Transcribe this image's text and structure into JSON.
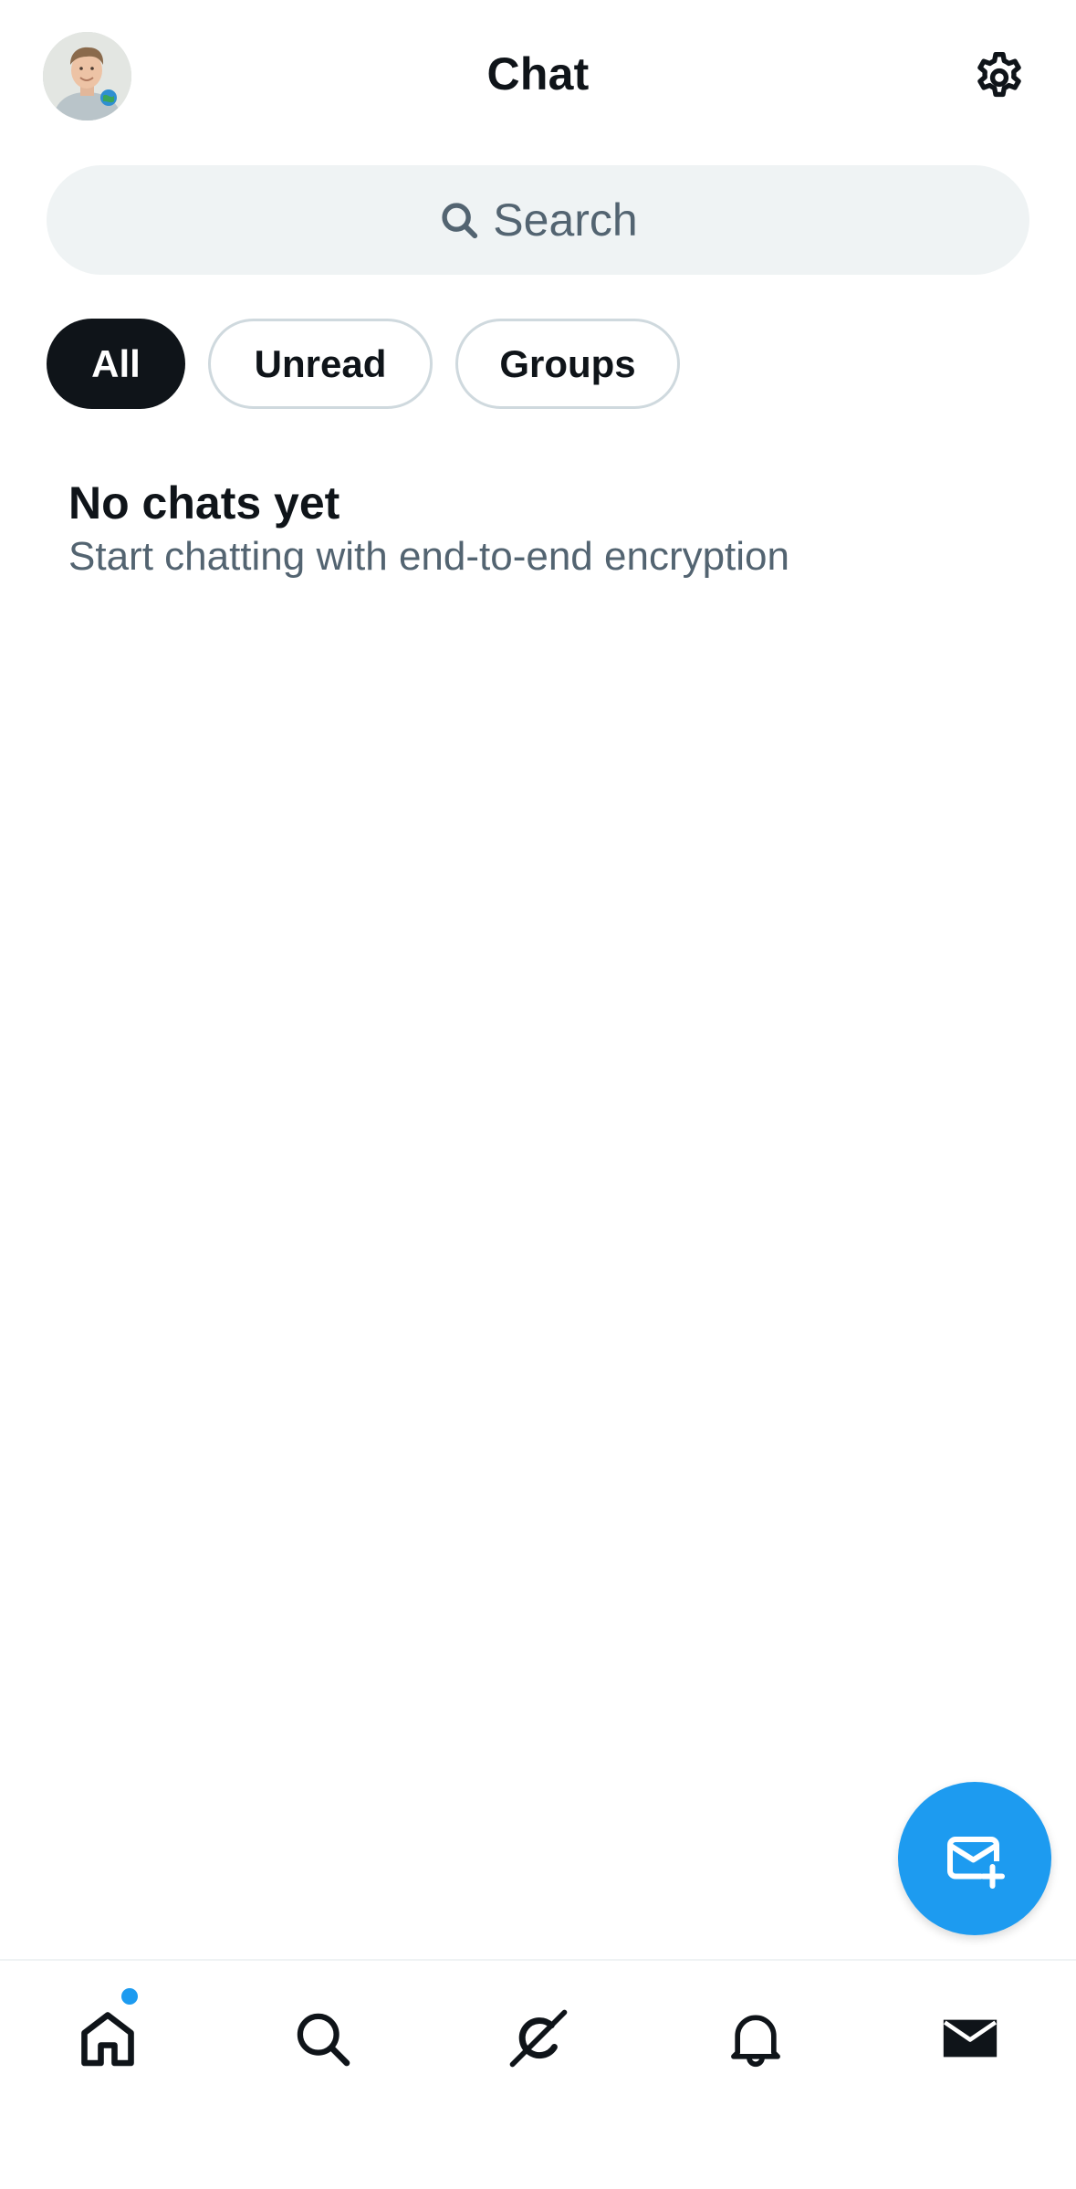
{
  "header": {
    "title": "Chat",
    "avatar_icon": "user-avatar",
    "settings_icon": "gear-icon"
  },
  "search": {
    "placeholder": "Search",
    "icon": "search-icon"
  },
  "filters": [
    {
      "label": "All",
      "active": true
    },
    {
      "label": "Unread",
      "active": false
    },
    {
      "label": "Groups",
      "active": false
    }
  ],
  "empty_state": {
    "title": "No chats yet",
    "subtitle": "Start chatting with end-to-end encryption"
  },
  "fab": {
    "icon": "new-message-icon"
  },
  "bottom_nav": {
    "items": [
      {
        "name": "home",
        "icon": "home-icon",
        "has_badge_dot": true
      },
      {
        "name": "search",
        "icon": "search-icon"
      },
      {
        "name": "grok",
        "icon": "grok-icon"
      },
      {
        "name": "notifications",
        "icon": "bell-icon"
      },
      {
        "name": "messages",
        "icon": "mail-icon",
        "active": true
      }
    ]
  },
  "colors": {
    "accent": "#1d9bf0",
    "text_primary": "#0f1419",
    "text_secondary": "#536471",
    "search_bg": "#eff3f4",
    "pill_border": "#cfd9de"
  }
}
